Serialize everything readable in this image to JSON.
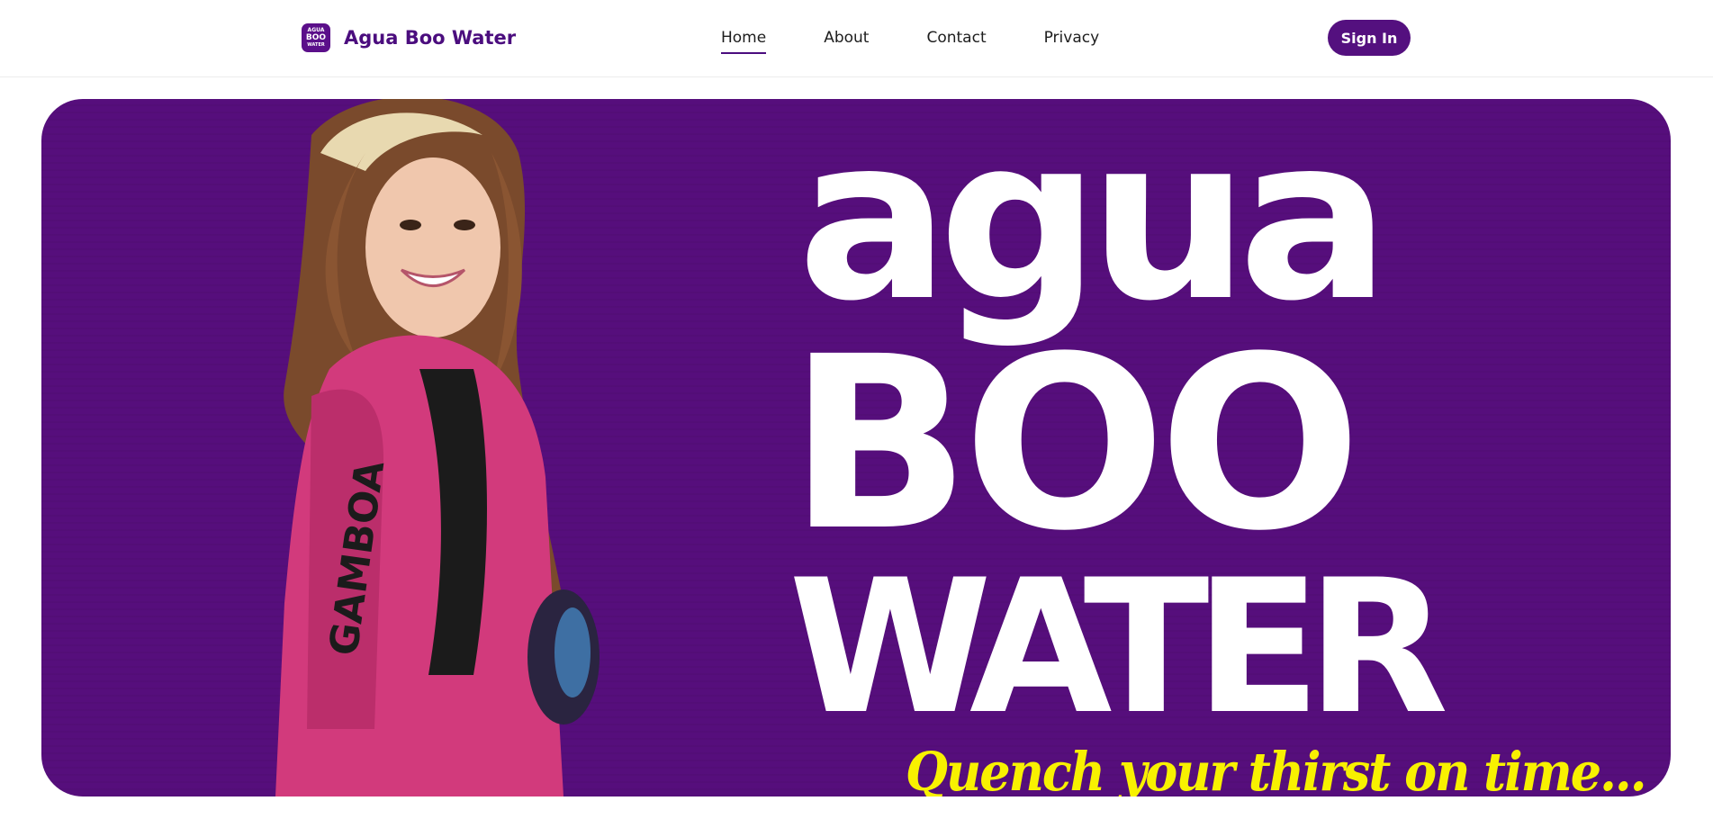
{
  "header": {
    "brand_name": "Agua Boo Water",
    "logo_text": [
      "AGUA",
      "BOO",
      "WATER"
    ],
    "nav": [
      {
        "label": "Home",
        "active": true
      },
      {
        "label": "About",
        "active": false
      },
      {
        "label": "Contact",
        "active": false
      },
      {
        "label": "Privacy",
        "active": false
      }
    ],
    "signin_label": "Sign In"
  },
  "hero": {
    "title_line1": "agua",
    "title_line2": "BOO",
    "title_line3": "WATER",
    "tagline": "Quench your thirst on time...",
    "jacket_text": "GAMBOA",
    "colors": {
      "background": "#560e7c",
      "title": "#ffffff",
      "tagline": "#f8f100",
      "jacket": "#d23a7c"
    }
  },
  "theme": {
    "brand_purple": "#4b0d7e",
    "button_purple": "#54107f"
  }
}
